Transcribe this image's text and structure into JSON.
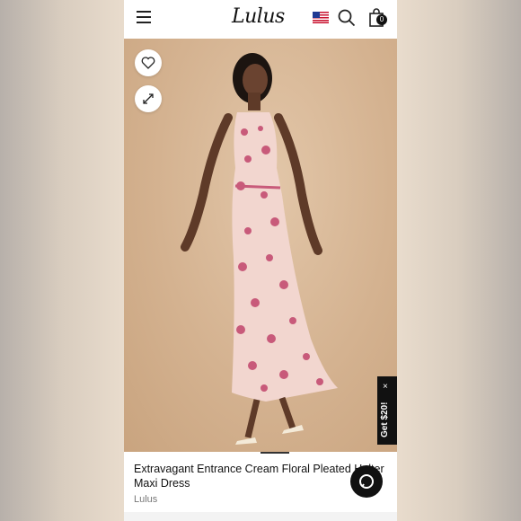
{
  "header": {
    "logo_text": "Lulus",
    "cart_count": "0",
    "flag_icon": "us-flag-icon",
    "search_icon": "search-icon",
    "bag_icon": "shopping-bag-icon",
    "menu_icon": "hamburger-menu-icon"
  },
  "product": {
    "title_line1": "Extravagant Entrance Cream Floral Pleated Halter",
    "title_line2": "Maxi Dress",
    "brand": "Lulus"
  },
  "promo": {
    "label": "Get $20!",
    "close": "×"
  },
  "colors": {
    "accent": "#111111",
    "image_bg": "#d4b290",
    "dress_pink": "#c85a7a"
  }
}
